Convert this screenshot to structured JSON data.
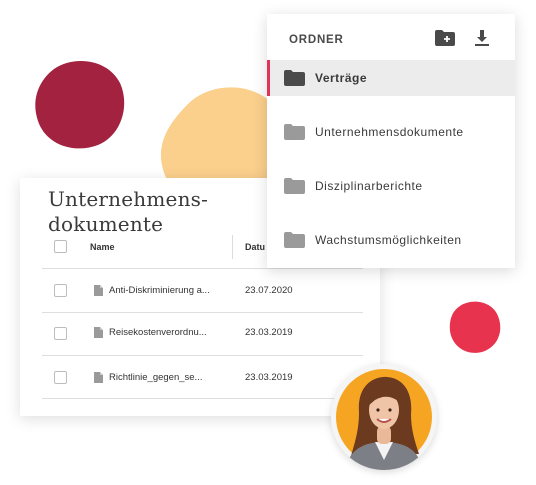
{
  "colors": {
    "accent": "#e03559",
    "blob_wine": "#a3223f",
    "blob_peach": "#fbcf8c",
    "blob_red": "#e8334f",
    "folder_gray": "#9a9a9a",
    "avatar_bg": "#f6a523"
  },
  "folders": {
    "header": "ORDNER",
    "new_folder_icon": "folder-plus-icon",
    "download_icon": "download-icon",
    "items": [
      {
        "label": "Verträge",
        "active": true
      },
      {
        "label": "Unternehmensdokumente",
        "active": false
      },
      {
        "label": "Disziplinarberichte",
        "active": false
      },
      {
        "label": "Wachstumsmöglichkeiten",
        "active": false
      }
    ]
  },
  "documents": {
    "title": "Unternehmens-dokumente",
    "columns": {
      "name": "Name",
      "date": "Datu"
    },
    "rows": [
      {
        "name": "Anti-Diskriminierung a...",
        "date": "23.07.2020"
      },
      {
        "name": "Reisekostenverordnu...",
        "date": "23.03.2019"
      },
      {
        "name": "Richtlinie_gegen_se...",
        "date": "23.03.2019"
      }
    ]
  },
  "avatar": {
    "icon": "user-photo"
  }
}
